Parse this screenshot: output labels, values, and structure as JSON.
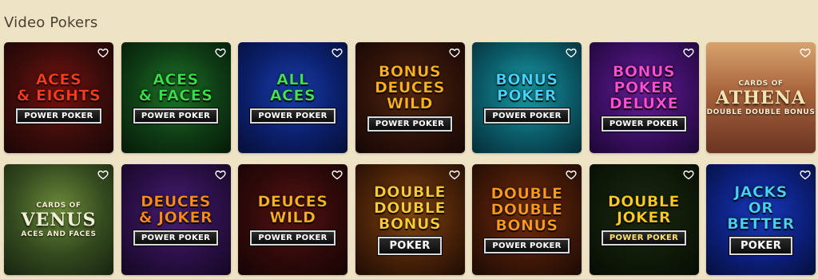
{
  "section": {
    "title": "Video Pokers"
  },
  "games": [
    {
      "title": "ACES\n& EIGHTS",
      "badge": "POWER POKER",
      "bg": "radial-gradient(circle at 50% 45%, #7a1410 0%, #3a0c0a 55%, #1a0706 100%)",
      "color": "#ff3b1f"
    },
    {
      "title": "ACES\n& FACES",
      "badge": "POWER POKER",
      "bg": "radial-gradient(circle at 50% 45%, #1f7a2a 0%, #0e3b14 55%, #061a08 100%)",
      "color": "#39e04a"
    },
    {
      "title": "ALL\nACES",
      "badge": "POWER POKER",
      "bg": "radial-gradient(circle at 50% 45%, #1a3fb0 0%, #0b1f6a 55%, #060f38 100%)",
      "color": "#42e35a"
    },
    {
      "title": "BONUS\nDEUCES\nWILD",
      "badge": "POWER POKER",
      "bg": "radial-gradient(circle at 50% 45%, #5a2a12 0%, #2e1208 55%, #150705 100%)",
      "color": "#ffb21f"
    },
    {
      "title": "BONUS\nPOKER",
      "badge": "POWER POKER",
      "bg": "radial-gradient(circle at 50% 45%, #1aa0a8 0%, #0b5a68 55%, #052c36 100%)",
      "color": "#46d4ff"
    },
    {
      "title": "BONUS\nPOKER\nDELUXE",
      "badge": "POWER POKER",
      "bg": "radial-gradient(circle at 50% 45%, #6e1fa0 0%, #3b0f62 55%, #1c0734 100%)",
      "color": "#ff4fd8"
    },
    {
      "title": "CARDS OF",
      "main": "ATHENA",
      "sub": "DOUBLE DOUBLE BONUS",
      "bg": "linear-gradient(#d7a36d 0%, #a9633c 45%, #6a3522 100%)",
      "color": "#f6e4b3"
    },
    {
      "title": "CARDS OF",
      "main": "VENUS",
      "sub": "ACES AND FACES",
      "bg": "radial-gradient(circle at 50% 40%, #6c8a3a 0%, #33491e 55%, #172410 100%)",
      "color": "#f2f0d6"
    },
    {
      "title": "DEUCES\n& JOKER",
      "badge": "POWER POKER",
      "bg": "radial-gradient(circle at 50% 45%, #4a1f76 0%, #2a0f46 55%, #140722 100%)",
      "color": "#ff8a1f"
    },
    {
      "title": "DEUCES\nWILD",
      "badge": "POWER POKER",
      "bg": "radial-gradient(circle at 50% 45%, #5a1414 0%, #2f0909 55%, #170404 100%)",
      "color": "#ffb21f"
    },
    {
      "title": "DOUBLE\nDOUBLE\nBONUS",
      "badge": "POKER",
      "bg": "radial-gradient(circle at 50% 45%, #8a4a12 0%, #4a2208 55%, #1e0c04 100%)",
      "color": "#ffcc33"
    },
    {
      "title": "DOUBLE\nDOUBLE\nBONUS",
      "badge": "POWER POKER",
      "bg": "radial-gradient(circle at 50% 45%, #7a3210 0%, #411807 55%, #1c0a04 100%)",
      "color": "#ff9a1f"
    },
    {
      "title": "DOUBLE\nJOKER",
      "badge": "POWER POKER",
      "bg": "radial-gradient(circle at 50% 45%, #1c2a12 0%, #0f1a08 55%, #070c04 100%)",
      "color": "#ffcc1f"
    },
    {
      "title": "JACKS\nOR\nBETTER",
      "badge": "POKER",
      "bg": "radial-gradient(circle at 50% 45%, #1a3ac0 0%, #0c1f7a 55%, #060f3c 100%)",
      "color": "#46d4ff"
    }
  ],
  "favorite_icon": "heart-outline-icon"
}
